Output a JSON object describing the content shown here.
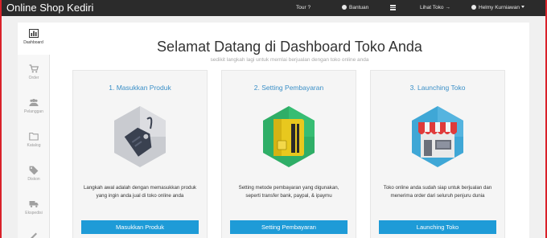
{
  "topbar": {
    "brand": "Online Shop Kediri",
    "tour": "Tour ?",
    "help": "Bantuan",
    "view_store": "Lihat Toko →",
    "user": "Helmy Kurniawan"
  },
  "sidebar": {
    "items": [
      {
        "label": "Dashboard",
        "icon": "bar-chart-icon"
      },
      {
        "label": "Order",
        "icon": "cart-icon"
      },
      {
        "label": "Pelanggan",
        "icon": "users-icon"
      },
      {
        "label": "Katalog",
        "icon": "folder-icon"
      },
      {
        "label": "Diskon",
        "icon": "tag-icon"
      },
      {
        "label": "Ekspedisi",
        "icon": "truck-icon"
      }
    ]
  },
  "main": {
    "title": "Selamat Datang di Dashboard Toko Anda",
    "subtitle": "sedikit langkah lagi untuk memlai berjualan dengan toko online anda",
    "cards": [
      {
        "title": "1. Masukkan Produk",
        "desc_line1": "Langkah awal adalah dengan memasukkan produk",
        "desc_line2": "yang ingin anda jual di toko online anda",
        "button": "Masukkan Produk",
        "icon": "product-tag-icon"
      },
      {
        "title": "2. Setting Pembayaran",
        "desc_line1": "Setting metode pembayaran yang digunakan,",
        "desc_line2": "seperti transfer bank, paypal, & ipaymu",
        "button": "Setting Pembayaran",
        "icon": "payment-card-icon"
      },
      {
        "title": "3. Launching Toko",
        "desc_line1": "Toko online anda sudah siap untuk berjualan dan",
        "desc_line2": "menerima order dari seluruh penjuru dunia",
        "button": "Launching Toko",
        "icon": "storefront-icon"
      }
    ]
  },
  "colors": {
    "topbar": "#2b2b2b",
    "accent": "#1e9bd7",
    "card_title": "#3a8fc7"
  }
}
